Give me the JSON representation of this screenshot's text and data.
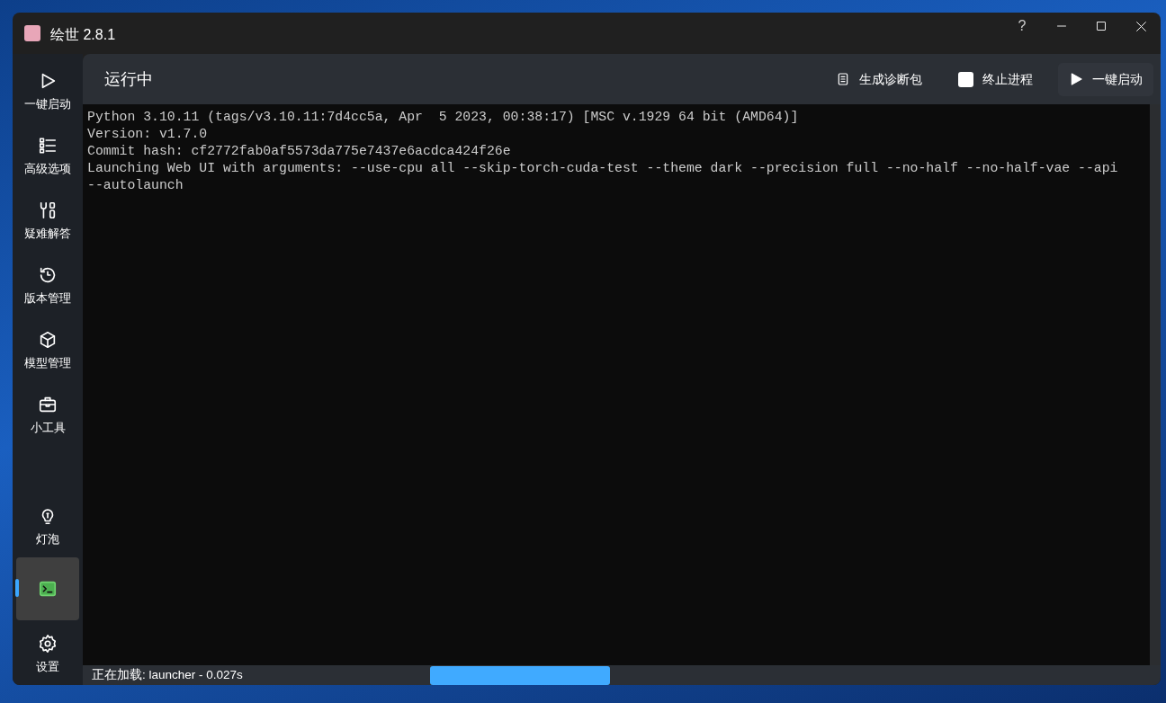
{
  "window": {
    "title": "绘世 2.8.1",
    "help": "?"
  },
  "sidebar": {
    "top_items": [
      {
        "label": "一键启动",
        "selected": false
      },
      {
        "label": "高级选项",
        "selected": false
      },
      {
        "label": "疑难解答",
        "selected": false
      },
      {
        "label": "版本管理",
        "selected": false
      },
      {
        "label": "模型管理",
        "selected": false
      },
      {
        "label": "小工具",
        "selected": false
      }
    ],
    "bottom_items": [
      {
        "label": "灯泡",
        "selected": false
      },
      {
        "selected": true
      },
      {
        "label": "设置",
        "selected": false
      }
    ]
  },
  "header": {
    "title": "运行中",
    "diagnostics_button": "生成诊断包",
    "terminate": {
      "label": "终止进程",
      "checked": false
    },
    "launch_button": "一键启动"
  },
  "console": {
    "lines": [
      "Python 3.10.11 (tags/v3.10.11:7d4cc5a, Apr  5 2023, 00:38:17) [MSC v.1929 64 bit (AMD64)]",
      "Version: v1.7.0",
      "Commit hash: cf2772fab0af5573da775e7437e6acdca424f26e",
      "Launching Web UI with arguments: --use-cpu all --skip-torch-cuda-test --theme dark --precision full --no-half --no-half-vae --api",
      "--autolaunch"
    ]
  },
  "status_bar": {
    "text": "正在加载: launcher - 0.027s"
  }
}
